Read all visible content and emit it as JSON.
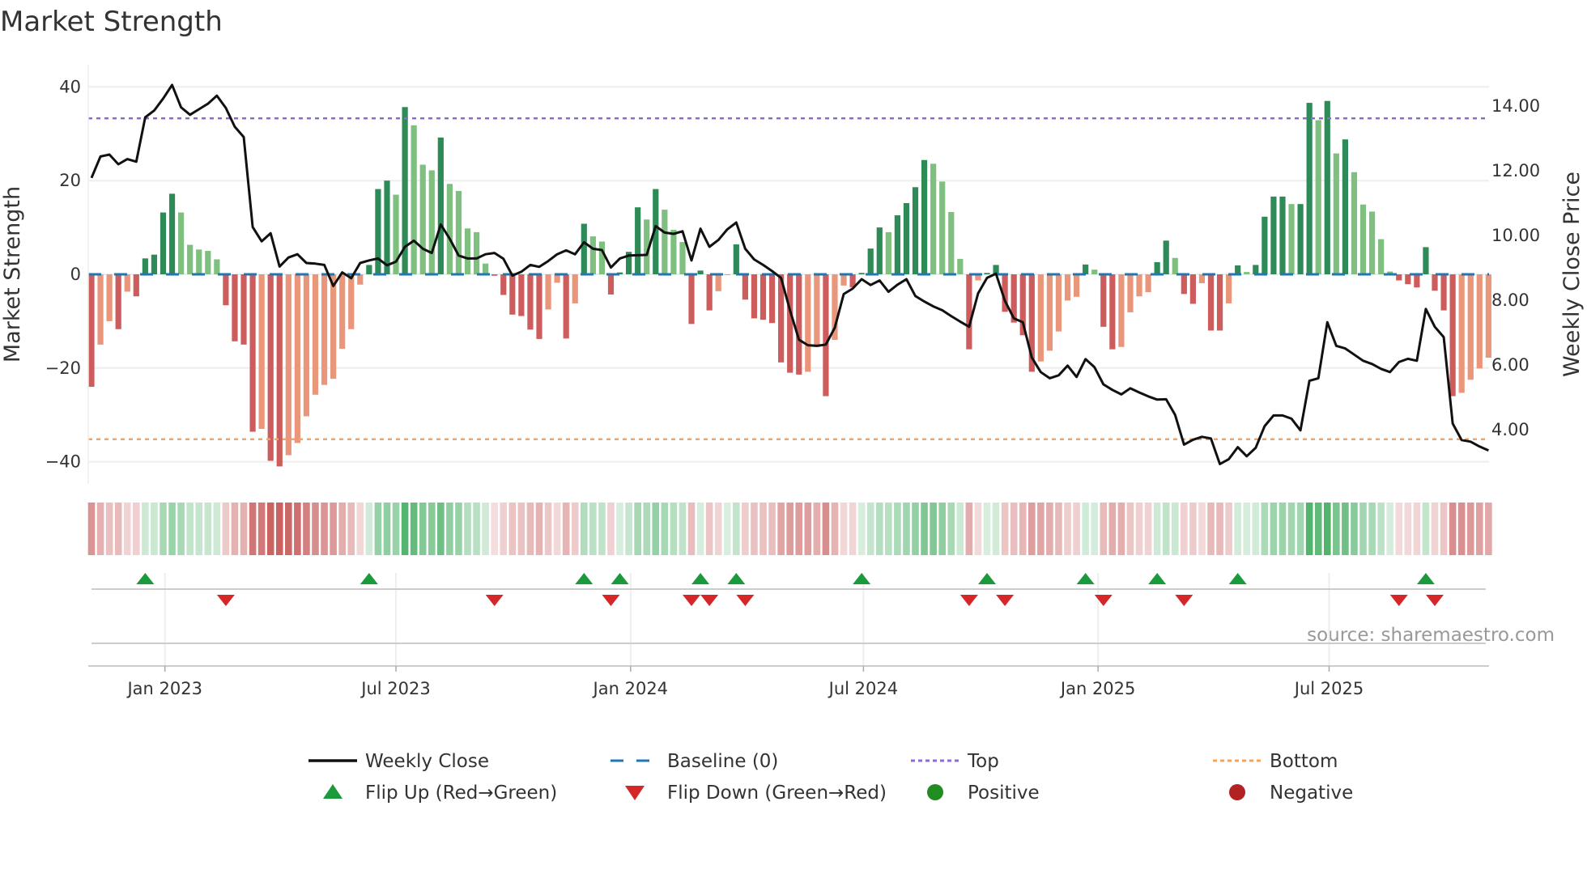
{
  "chart_data": {
    "type": "bar",
    "title": "Market Strength",
    "ylabel": "Market Strength",
    "y2label": "Weekly Close Price",
    "source": "source: sharemaestro.com",
    "ylim": [
      -44.7,
      44.7
    ],
    "y2lim": [
      2.34,
      15.28
    ],
    "yticks": [
      "40",
      "20",
      "0",
      "−20",
      "−40"
    ],
    "ytick_values": [
      40,
      20,
      0,
      -20,
      -40
    ],
    "y2ticks": [
      "14.00",
      "12.00",
      "10.00",
      "8.00",
      "6.00",
      "4.00"
    ],
    "y2tick_values": [
      14,
      12,
      10,
      8,
      6,
      4
    ],
    "xticks": [
      "Jan 2023",
      "Jul 2023",
      "Jan 2024",
      "Jul 2024",
      "Jan 2025",
      "Jul 2025"
    ],
    "xtick_week_index": [
      8.2,
      34,
      60.2,
      86.2,
      112.4,
      138.2
    ],
    "top_level": 33.3,
    "bottom_level": -35.2,
    "baseline": 0,
    "grid": true,
    "legend_position": "bottom",
    "colors": {
      "strong_pos": "#2e8b57",
      "weak_pos": "#7fbf7f",
      "strong_neg": "#cd5c5c",
      "weak_neg": "#e9967a",
      "line": "#111111",
      "baseline": "#1f77b4",
      "top": "#9467d4",
      "bottom": "#f4a460",
      "flip_up": "#1a9a3a",
      "flip_down": "#d62728",
      "positive": "#228b22",
      "negative": "#b22222"
    },
    "strength": [
      -24,
      -15,
      -10,
      -11.7,
      -3.7,
      -4.7,
      3.4,
      4.2,
      13.2,
      17.2,
      13.2,
      6.3,
      5.3,
      5,
      3.2,
      -6.6,
      -14.3,
      -15,
      -33.6,
      -33,
      -39.8,
      -41,
      -38.6,
      -36,
      -30.3,
      -25.7,
      -23.6,
      -22.3,
      -15.9,
      -11.7,
      -2.2,
      2,
      18.2,
      20,
      17,
      35.7,
      31.8,
      23.4,
      22.2,
      29.2,
      19.3,
      17.8,
      9.8,
      9,
      2.3,
      -0.3,
      -4.4,
      -8.6,
      -8.9,
      -11.8,
      -13.8,
      -7.5,
      -1.8,
      -13.7,
      -6.2,
      10.8,
      8.1,
      7,
      -4.3,
      0.4,
      4.8,
      14.3,
      11.7,
      18.2,
      13.8,
      9.5,
      6.9,
      -10.6,
      0.8,
      -7.7,
      -3.6,
      0,
      6.4,
      -5.4,
      -9.4,
      -9.7,
      -10.4,
      -18.8,
      -21,
      -21.4,
      -20.8,
      -15.5,
      -26,
      -14,
      -2.4,
      -2.8,
      0.3,
      5.5,
      10,
      9,
      12.6,
      15.2,
      18.6,
      24.4,
      23.6,
      19.8,
      13.3,
      3.3,
      -16,
      -1.3,
      0.3,
      2,
      -8,
      -10.3,
      -13,
      -20.8,
      -18.6,
      -16.3,
      -12.2,
      -5.6,
      -4.8,
      2.1,
      1,
      -11.2,
      -16,
      -15.5,
      -8.1,
      -4.7,
      -3.8,
      2.6,
      7.2,
      3.5,
      -4.2,
      -6.3,
      -1.9,
      -12,
      -12,
      -6.2,
      1.9,
      0.5,
      2,
      12.3,
      16.6,
      16.6,
      15,
      15,
      36.6,
      32.9,
      37,
      25.8,
      28.8,
      21.8,
      14.9,
      13.4,
      7.5,
      0.6,
      -1.3,
      -2.1,
      -2.8,
      5.8,
      -3.5,
      -7.7,
      -26,
      -25.3,
      -22.5,
      -20.1,
      -17.8
    ],
    "weekly_close": [
      11.78,
      12.44,
      12.5,
      12.2,
      12.36,
      12.28,
      13.65,
      13.86,
      14.23,
      14.65,
      13.96,
      13.73,
      13.9,
      14.07,
      14.32,
      13.94,
      13.36,
      13.04,
      10.26,
      9.82,
      10.07,
      9.04,
      9.32,
      9.42,
      9.15,
      9.13,
      9.09,
      8.44,
      8.86,
      8.68,
      9.15,
      9.23,
      9.29,
      9.08,
      9.19,
      9.65,
      9.84,
      9.59,
      9.46,
      10.34,
      9.9,
      9.38,
      9.29,
      9.29,
      9.42,
      9.46,
      9.28,
      8.76,
      8.88,
      9.09,
      9.03,
      9.21,
      9.42,
      9.54,
      9.42,
      9.79,
      9.59,
      9.55,
      9.01,
      9.29,
      9.38,
      9.39,
      9.4,
      10.29,
      10.09,
      10.05,
      10.13,
      9.23,
      10.21,
      9.65,
      9.86,
      10.19,
      10.4,
      9.59,
      9.26,
      9.09,
      8.9,
      8.69,
      7.69,
      6.78,
      6.61,
      6.59,
      6.63,
      7.15,
      8.19,
      8.36,
      8.65,
      8.47,
      8.61,
      8.26,
      8.48,
      8.65,
      8.13,
      7.96,
      7.81,
      7.69,
      7.51,
      7.34,
      7.18,
      8.21,
      8.69,
      8.82,
      7.98,
      7.44,
      7.32,
      6.23,
      5.78,
      5.59,
      5.68,
      5.98,
      5.63,
      6.18,
      5.93,
      5.4,
      5.23,
      5.09,
      5.28,
      5.15,
      5.03,
      4.93,
      4.94,
      4.46,
      3.54,
      3.69,
      3.78,
      3.73,
      2.94,
      3.09,
      3.46,
      3.18,
      3.44,
      4.11,
      4.44,
      4.44,
      4.34,
      3.98,
      5.51,
      5.59,
      7.32,
      6.59,
      6.51,
      6.32,
      6.13,
      6.03,
      5.88,
      5.78,
      6.09,
      6.19,
      6.13,
      7.73,
      7.18,
      6.86,
      4.19,
      3.68,
      3.63,
      3.48,
      3.36
    ]
  },
  "legend": [
    {
      "label": "Weekly Close",
      "kind": "line"
    },
    {
      "label": "Baseline (0)",
      "kind": "dash"
    },
    {
      "label": "Top",
      "kind": "dot-purple"
    },
    {
      "label": "Bottom",
      "kind": "dot-orange"
    },
    {
      "label": "Flip Up (Red→Green)",
      "kind": "tri-up"
    },
    {
      "label": "Flip Down (Green→Red)",
      "kind": "tri-down"
    },
    {
      "label": "Positive",
      "kind": "circle-green"
    },
    {
      "label": "Negative",
      "kind": "circle-red"
    }
  ]
}
